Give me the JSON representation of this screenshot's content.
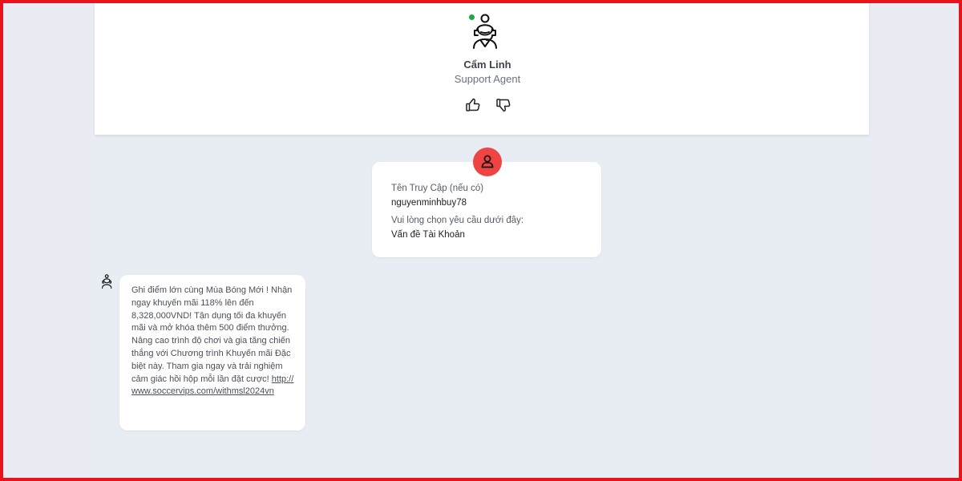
{
  "agent": {
    "name": "Cẩm Linh",
    "role": "Support Agent",
    "status_color": "#22a447",
    "avatar_icon": "support-agent-headset-icon",
    "rate_up_icon": "thumbs-up-icon",
    "rate_down_icon": "thumbs-down-icon"
  },
  "user_form": {
    "avatar_icon": "user-icon",
    "avatar_color": "#ef4444",
    "fields": [
      {
        "label": "Tên Truy Cập (nếu có)",
        "value": "nguyenminhbuy78"
      },
      {
        "label": "Vui lòng chọn yêu cầu dưới đây:",
        "value": "Vấn đề Tài Khoản"
      }
    ]
  },
  "bot_message": {
    "avatar_icon": "agent-mini-icon",
    "text": "Ghi điểm lớn cùng Mùa Bóng Mới ! Nhận ngay khuyến mãi 118% lên đến 8,328,000VND! Tận dụng tối đa khuyến mãi và mở khóa thêm 500 điểm thưởng. Nâng cao trình độ chơi và gia tăng chiến thắng với Chương trình Khuyến mãi Đặc biệt này. Tham gia ngay và trải nghiệm cảm giác hồi hộp mỗi lần đặt cược!",
    "link": "http://www.soccervips.com/withmsl2024vn"
  },
  "colors": {
    "frame": "#e8141c",
    "panel_bg": "#e8ecf3",
    "card_bg": "#ffffff"
  }
}
